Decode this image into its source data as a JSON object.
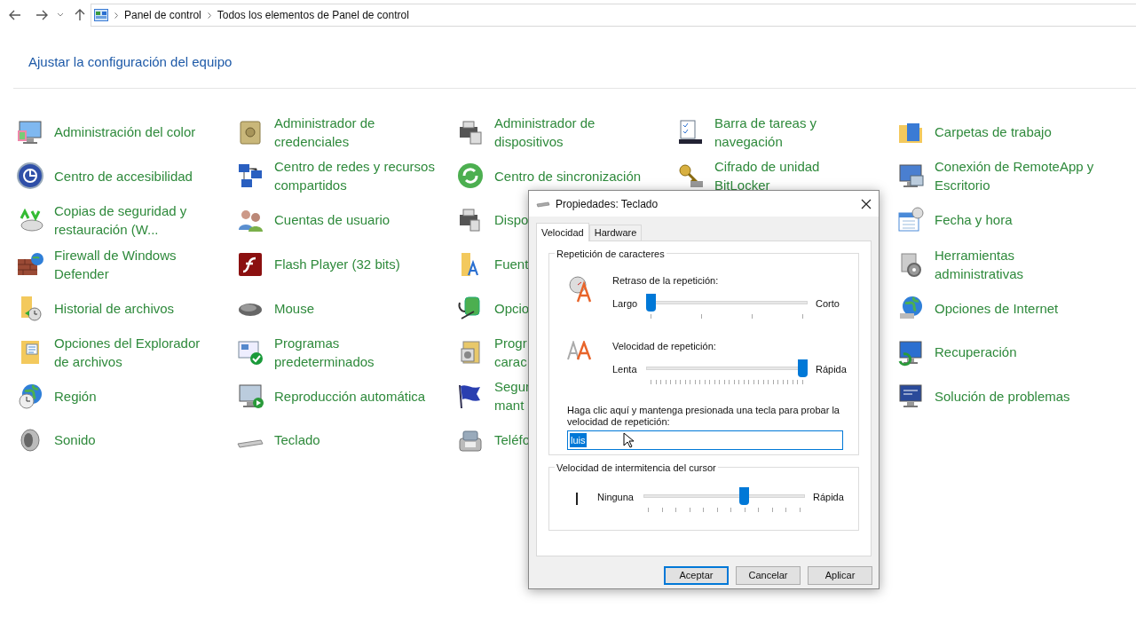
{
  "nav": {
    "breadcrumb": [
      "Panel de control",
      "Todos los elementos de Panel de control"
    ]
  },
  "heading": "Ajustar la configuración del equipo",
  "columns": [
    [
      {
        "lines": [
          "Administración del color"
        ]
      },
      {
        "lines": [
          "Centro de accesibilidad"
        ]
      },
      {
        "lines": [
          "Copias de seguridad y",
          "restauración (W..."
        ]
      },
      {
        "lines": [
          "Firewall de Windows",
          "Defender"
        ]
      },
      {
        "lines": [
          "Historial de archivos"
        ]
      },
      {
        "lines": [
          "Opciones del Explorador",
          "de archivos"
        ]
      },
      {
        "lines": [
          "Región"
        ]
      },
      {
        "lines": [
          "Sonido"
        ]
      }
    ],
    [
      {
        "lines": [
          "Administrador de",
          "credenciales"
        ]
      },
      {
        "lines": [
          "Centro de redes y recursos",
          "compartidos"
        ]
      },
      {
        "lines": [
          "Cuentas de usuario"
        ]
      },
      {
        "lines": [
          "Flash Player (32 bits)"
        ]
      },
      {
        "lines": [
          "Mouse"
        ]
      },
      {
        "lines": [
          "Programas",
          "predeterminados"
        ]
      },
      {
        "lines": [
          "Reproducción automática"
        ]
      },
      {
        "lines": [
          "Teclado"
        ]
      }
    ],
    [
      {
        "lines": [
          "Administrador de",
          "dispositivos"
        ]
      },
      {
        "lines": [
          "Centro de sincronización"
        ]
      },
      {
        "lines": [
          "Dispo"
        ]
      },
      {
        "lines": [
          "Fuent"
        ]
      },
      {
        "lines": [
          "Opcio"
        ]
      },
      {
        "lines": [
          "Progr",
          "carac"
        ]
      },
      {
        "lines": [
          "Segur",
          "mant"
        ]
      },
      {
        "lines": [
          "Teléfo"
        ]
      }
    ],
    [
      {
        "lines": [
          "Barra de tareas y",
          "navegación"
        ]
      },
      {
        "lines": [
          "Cifrado de unidad",
          "BitLocker"
        ]
      }
    ],
    [
      {
        "lines": [
          "Carpetas de trabajo"
        ]
      },
      {
        "lines": [
          "Conexión de RemoteApp y",
          "Escritorio"
        ]
      },
      {
        "lines": [
          "Fecha y hora"
        ]
      },
      {
        "lines": [
          "Herramientas",
          "administrativas"
        ]
      },
      {
        "lines": [
          "Opciones de Internet"
        ]
      },
      {
        "lines": [
          "Recuperación"
        ]
      },
      {
        "lines": [
          "Solución de problemas"
        ]
      }
    ]
  ],
  "dialog": {
    "title": "Propiedades: Teclado",
    "tabs": [
      {
        "label": "Velocidad",
        "selected": true
      },
      {
        "label": "Hardware",
        "selected": false
      }
    ],
    "repeat_group": {
      "title": "Repetición de caracteres",
      "sliders": [
        {
          "label": "Retraso de la repetición:",
          "min_label": "Largo",
          "max_label": "Corto",
          "level": 0
        },
        {
          "label": "Velocidad de repetición:",
          "min_label": "Lenta",
          "max_label": "Rápida",
          "level": 1
        }
      ],
      "test_prompt": "Haga clic aquí y mantenga presionada una tecla para probar la velocidad de repetición:",
      "test_field": {
        "value": "luis",
        "selected": true
      }
    },
    "blink_group": {
      "title": "Velocidad de intermitencia del cursor",
      "slider": {
        "min_label": "Ninguna",
        "max_label": "Rápida",
        "level": 0.63
      }
    },
    "buttons": [
      {
        "label": "Aceptar",
        "default": true
      },
      {
        "label": "Cancelar",
        "default": false
      },
      {
        "label": "Aplicar",
        "default": false
      }
    ]
  }
}
